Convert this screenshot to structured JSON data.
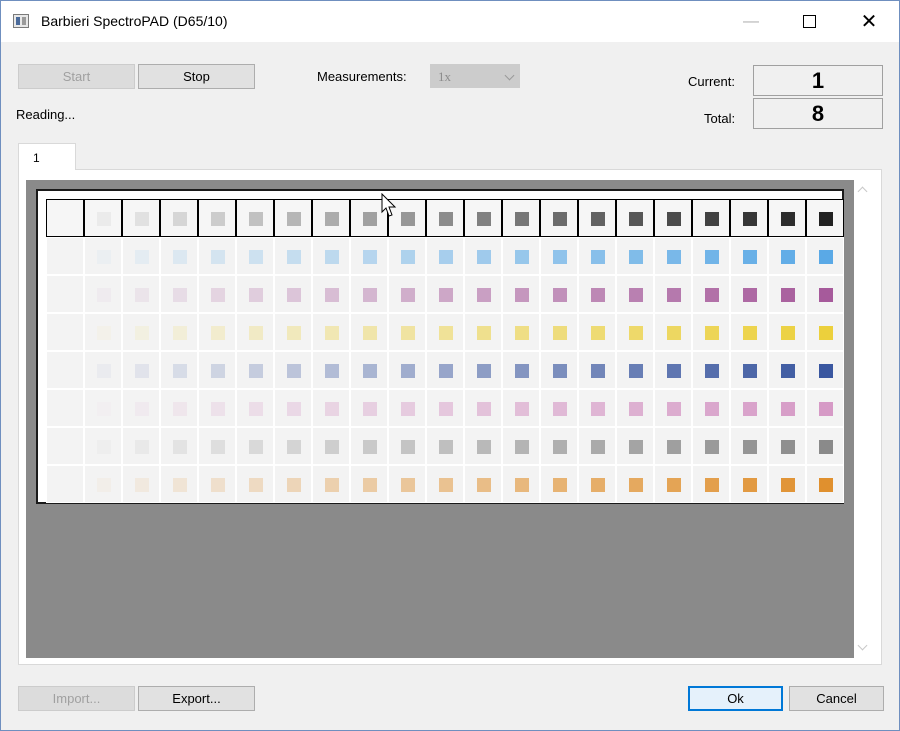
{
  "window": {
    "title": "Barbieri SpectroPAD (D65/10)"
  },
  "controls": {
    "start_label": "Start",
    "stop_label": "Stop",
    "measurements_label": "Measurements:",
    "measurements_value": "1x",
    "status_text": "Reading...",
    "current_label": "Current:",
    "current_value": "1",
    "total_label": "Total:",
    "total_value": "8"
  },
  "tabs": [
    {
      "label": "1"
    }
  ],
  "footer": {
    "import_label": "Import...",
    "export_label": "Export...",
    "ok_label": "Ok",
    "cancel_label": "Cancel"
  },
  "patch_chart": {
    "columns": 21,
    "measured_rows": 1,
    "rows": [
      {
        "name": "black",
        "color": "#222222"
      },
      {
        "name": "cyan",
        "color": "#5aa9e6"
      },
      {
        "name": "magenta",
        "color": "#a65a9b"
      },
      {
        "name": "yellow",
        "color": "#ecd03c"
      },
      {
        "name": "blue",
        "color": "#3a57a0"
      },
      {
        "name": "light-magenta",
        "color": "#d69ac6"
      },
      {
        "name": "gray",
        "color": "#8a8a8a"
      },
      {
        "name": "orange",
        "color": "#e0902e"
      }
    ]
  }
}
